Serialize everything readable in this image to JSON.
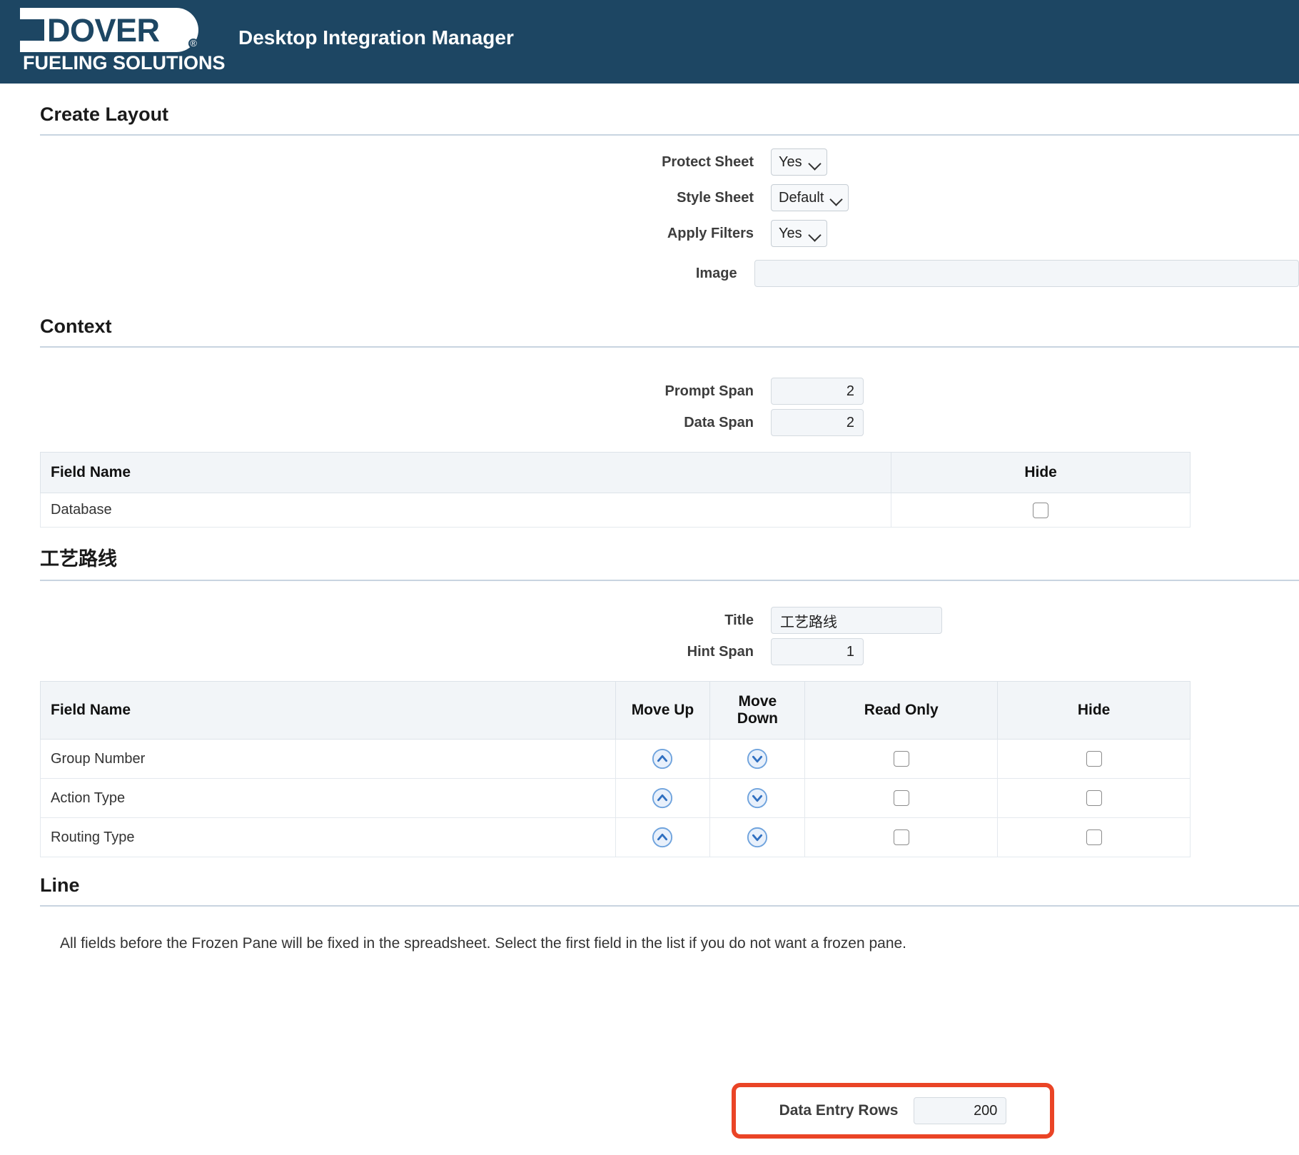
{
  "header": {
    "logo_primary": "DOVER",
    "logo_registered": "®",
    "logo_tagline": "FUELING SOLUTIONS",
    "app_title": "Desktop Integration Manager",
    "background_color": "#1d4663"
  },
  "create_layout": {
    "section_title": "Create Layout",
    "fields": {
      "protect_sheet": {
        "label": "Protect Sheet",
        "value": "Yes"
      },
      "style_sheet": {
        "label": "Style Sheet",
        "value": "Default"
      },
      "apply_filters": {
        "label": "Apply Filters",
        "value": "Yes"
      },
      "image": {
        "label": "Image",
        "value": "",
        "placeholder": ""
      }
    }
  },
  "context": {
    "section_title": "Context",
    "fields": {
      "prompt_span": {
        "label": "Prompt Span",
        "value": "2"
      },
      "data_span": {
        "label": "Data Span",
        "value": "2"
      }
    },
    "table": {
      "columns": [
        "Field Name",
        "Hide"
      ],
      "rows": [
        {
          "field_name": "Database",
          "hide": false
        }
      ]
    }
  },
  "routing": {
    "section_title": "工艺路线",
    "fields": {
      "title": {
        "label": "Title",
        "value": "工艺路线"
      },
      "hint_span": {
        "label": "Hint Span",
        "value": "1"
      }
    },
    "table": {
      "columns": [
        "Field Name",
        "Move Up",
        "Move Down",
        "Read Only",
        "Hide"
      ],
      "rows": [
        {
          "field_name": "Group Number",
          "read_only": false,
          "hide": false
        },
        {
          "field_name": "Action Type",
          "read_only": false,
          "hide": false
        },
        {
          "field_name": "Routing Type",
          "read_only": false,
          "hide": false
        }
      ]
    }
  },
  "line": {
    "section_title": "Line",
    "hint": "All fields before the Frozen Pane will be fixed in the spreadsheet. Select the first field in the list if you do not want a frozen pane.",
    "data_entry_rows": {
      "label": "Data Entry Rows",
      "value": "200"
    },
    "highlight_color": "#ea4426"
  },
  "icons": {
    "move_up": "chevron-up-circle-icon",
    "move_down": "chevron-down-circle-icon",
    "dropdown": "chevron-down-icon"
  }
}
